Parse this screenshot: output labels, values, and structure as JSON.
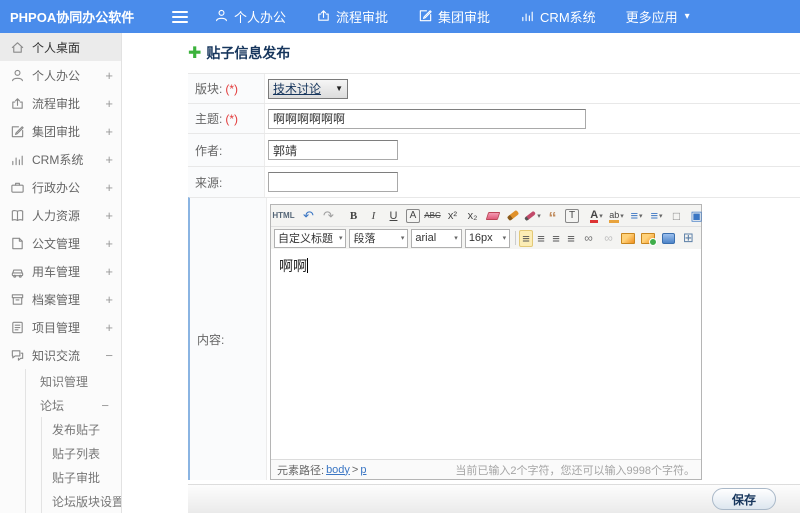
{
  "navbar": {
    "brand": "PHPOA协同办公软件",
    "items": [
      {
        "icon": "user-icon",
        "label": "个人办公"
      },
      {
        "icon": "process-icon",
        "label": "流程审批"
      },
      {
        "icon": "edit-icon",
        "label": "集团审批"
      },
      {
        "icon": "chart-icon",
        "label": "CRM系统"
      },
      {
        "icon": "more-icon",
        "label": "更多应用",
        "caret": "▾"
      }
    ],
    "bg_color": "#4a8ceb"
  },
  "sidebar": {
    "items": [
      {
        "label": "个人桌面",
        "icon": "home-icon",
        "expand": ""
      },
      {
        "label": "个人办公",
        "icon": "user-icon",
        "expand": "+"
      },
      {
        "label": "流程审批",
        "icon": "process-icon",
        "expand": "+"
      },
      {
        "label": "集团审批",
        "icon": "edit-icon",
        "expand": "+"
      },
      {
        "label": "CRM系统",
        "icon": "chart-icon",
        "expand": "+"
      },
      {
        "label": "行政办公",
        "icon": "briefcase-icon",
        "expand": "+"
      },
      {
        "label": "人力资源",
        "icon": "book-icon",
        "expand": "+"
      },
      {
        "label": "公文管理",
        "icon": "document-icon",
        "expand": "+"
      },
      {
        "label": "用车管理",
        "icon": "car-icon",
        "expand": "+"
      },
      {
        "label": "档案管理",
        "icon": "archive-icon",
        "expand": "+"
      },
      {
        "label": "项目管理",
        "icon": "project-icon",
        "expand": "+"
      },
      {
        "label": "知识交流",
        "icon": "chat-icon",
        "expand": "−"
      },
      {
        "label": "知识管理",
        "expand": ""
      },
      {
        "label": "论坛",
        "expand": "−"
      },
      {
        "label": "发布贴子",
        "expand": ""
      },
      {
        "label": "贴子列表",
        "expand": ""
      },
      {
        "label": "贴子审批",
        "expand": ""
      },
      {
        "label": "论坛版块设置",
        "expand": ""
      }
    ]
  },
  "main": {
    "title": "贴子信息发布",
    "title_icon": "✚",
    "form": {
      "rows": [
        {
          "label": "版块:",
          "required": "(*)",
          "value": "技术讨论"
        },
        {
          "label": "主题:",
          "required": "(*)",
          "value": "啊啊啊啊啊啊"
        },
        {
          "label": "作者:",
          "value": "郭靖"
        },
        {
          "label": "来源:",
          "value": ""
        },
        {
          "label": "内容:"
        }
      ],
      "select_arrow": "▼"
    },
    "editor": {
      "t1": [
        {
          "name": "html-source-button",
          "glyph": "HTML"
        },
        {
          "name": "undo-icon",
          "glyph": "↶"
        },
        {
          "name": "redo-icon",
          "glyph": "↷"
        },
        {
          "name": "bold-button",
          "glyph": "B"
        },
        {
          "name": "italic-button",
          "glyph": "I"
        },
        {
          "name": "underline-button",
          "glyph": "U"
        },
        {
          "name": "font-box-button",
          "glyph": "A"
        },
        {
          "name": "strikethrough-button",
          "glyph": "ABC"
        },
        {
          "name": "superscript-button",
          "glyph": "x²"
        },
        {
          "name": "subscript-button",
          "glyph": "x₂"
        },
        {
          "name": "remove-format-icon",
          "glyph": ""
        },
        {
          "name": "format-brush-icon",
          "glyph": ""
        },
        {
          "name": "quick-style-icon",
          "glyph": "",
          "caret": "▾"
        },
        {
          "name": "blockquote-button",
          "glyph": "“"
        },
        {
          "name": "paste-text-icon",
          "glyph": "T"
        },
        {
          "name": "font-color-button",
          "glyph": "A",
          "caret": "▾"
        },
        {
          "name": "highlight-color-button",
          "glyph": "ab",
          "caret": "▾"
        },
        {
          "name": "ordered-list-button",
          "glyph": "≡",
          "caret": "▾"
        },
        {
          "name": "unordered-list-button",
          "glyph": "≡",
          "caret": "▾"
        },
        {
          "name": "new-page-icon",
          "glyph": "□"
        },
        {
          "name": "fullscreen-icon",
          "glyph": "▣"
        }
      ],
      "t2_selects": [
        {
          "name": "custom-title-select",
          "value": "自定义标题",
          "caret": "▾"
        },
        {
          "name": "paragraph-select",
          "value": "段落",
          "caret": "▾"
        },
        {
          "name": "font-family-select",
          "value": "arial",
          "caret": "▾"
        },
        {
          "name": "font-size-select",
          "value": "16px",
          "caret": "▾"
        }
      ],
      "t2_icons": [
        {
          "name": "align-left-button",
          "glyph": "≡",
          "active": true
        },
        {
          "name": "align-center-button",
          "glyph": "≡"
        },
        {
          "name": "align-right-button",
          "glyph": "≡"
        },
        {
          "name": "align-justify-button",
          "glyph": "≡"
        },
        {
          "name": "link-button",
          "glyph": "∞"
        },
        {
          "name": "unlink-button",
          "glyph": "∞"
        },
        {
          "name": "insert-image-button",
          "glyph": ""
        },
        {
          "name": "net-image-button",
          "glyph": ""
        },
        {
          "name": "insert-media-button",
          "glyph": ""
        },
        {
          "name": "insert-table-button",
          "glyph": "⊞"
        }
      ],
      "content": "啊啊",
      "status": {
        "path_label": "元素路径: ",
        "path_body": "body",
        "path_sep": " > ",
        "path_p": "p",
        "right": "当前已输入2个字符，您还可以输入9998个字符。"
      }
    },
    "save_label": "保存"
  }
}
